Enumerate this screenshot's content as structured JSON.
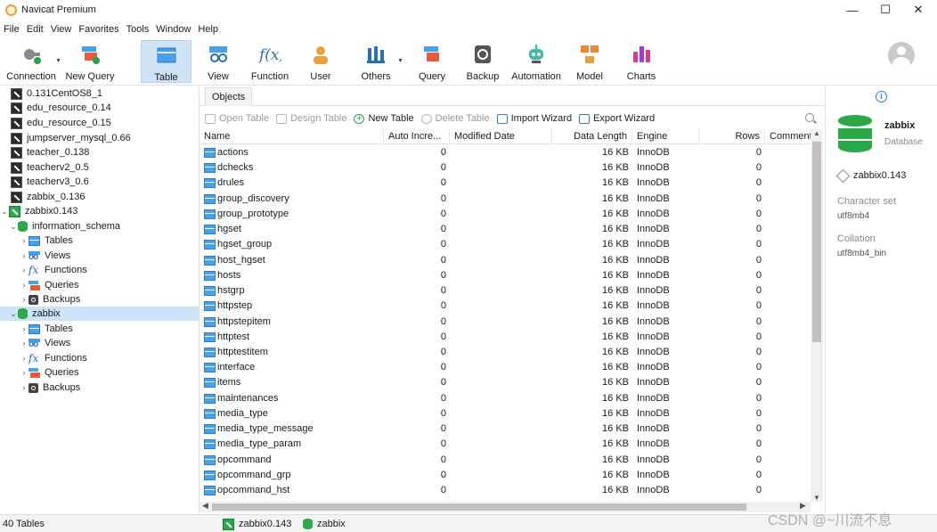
{
  "window": {
    "title": "Navicat Premium",
    "minimize": "—",
    "maximize": "☐",
    "close": "✕"
  },
  "menu": [
    "File",
    "Edit",
    "View",
    "Favorites",
    "Tools",
    "Window",
    "Help"
  ],
  "toolbar": {
    "items": [
      {
        "label": "Connection",
        "icon": "connection-icon"
      },
      {
        "label": "New Query",
        "icon": "new-query-icon"
      },
      {
        "label": "Table",
        "icon": "table-icon",
        "active": true
      },
      {
        "label": "View",
        "icon": "view-icon"
      },
      {
        "label": "Function",
        "icon": "function-icon"
      },
      {
        "label": "User",
        "icon": "user-icon"
      },
      {
        "label": "Others",
        "icon": "others-icon"
      },
      {
        "label": "Query",
        "icon": "query-icon"
      },
      {
        "label": "Backup",
        "icon": "backup-icon"
      },
      {
        "label": "Automation",
        "icon": "automation-icon"
      },
      {
        "label": "Model",
        "icon": "model-icon"
      },
      {
        "label": "Charts",
        "icon": "charts-icon"
      }
    ]
  },
  "navigator": {
    "connections": [
      {
        "label": "0.131CentOS8_1"
      },
      {
        "label": "edu_resource_0.14"
      },
      {
        "label": "edu_resource_0.15"
      },
      {
        "label": "jumpserver_mysql_0.66"
      },
      {
        "label": "teacher_0.138"
      },
      {
        "label": "teacherv2_0.5"
      },
      {
        "label": "teacherv3_0.6"
      },
      {
        "label": "zabbix_0.136"
      }
    ],
    "open_connection": "zabbix0.143",
    "databases": [
      {
        "label": "information_schema",
        "children": [
          "Tables",
          "Views",
          "Functions",
          "Queries",
          "Backups"
        ]
      },
      {
        "label": "zabbix",
        "selected": true,
        "children": [
          "Tables",
          "Views",
          "Functions",
          "Queries",
          "Backups"
        ]
      }
    ]
  },
  "tabs": {
    "objects": "Objects"
  },
  "object_toolbar": {
    "open_table": "Open Table",
    "design_table": "Design Table",
    "new_table": "New Table",
    "delete_table": "Delete Table",
    "import_wizard": "Import Wizard",
    "export_wizard": "Export Wizard"
  },
  "grid": {
    "columns": [
      "Name",
      "Auto Incre...",
      "Modified Date",
      "Data Length",
      "Engine",
      "Rows",
      "Comment"
    ],
    "rows": [
      {
        "name": "actions",
        "auto": "0",
        "modified": "",
        "length": "16 KB",
        "engine": "InnoDB",
        "rows": "0"
      },
      {
        "name": "dchecks",
        "auto": "0",
        "modified": "",
        "length": "16 KB",
        "engine": "InnoDB",
        "rows": "0"
      },
      {
        "name": "drules",
        "auto": "0",
        "modified": "",
        "length": "16 KB",
        "engine": "InnoDB",
        "rows": "0"
      },
      {
        "name": "group_discovery",
        "auto": "0",
        "modified": "",
        "length": "16 KB",
        "engine": "InnoDB",
        "rows": "0"
      },
      {
        "name": "group_prototype",
        "auto": "0",
        "modified": "",
        "length": "16 KB",
        "engine": "InnoDB",
        "rows": "0"
      },
      {
        "name": "hgset",
        "auto": "0",
        "modified": "",
        "length": "16 KB",
        "engine": "InnoDB",
        "rows": "0"
      },
      {
        "name": "hgset_group",
        "auto": "0",
        "modified": "",
        "length": "16 KB",
        "engine": "InnoDB",
        "rows": "0"
      },
      {
        "name": "host_hgset",
        "auto": "0",
        "modified": "",
        "length": "16 KB",
        "engine": "InnoDB",
        "rows": "0"
      },
      {
        "name": "hosts",
        "auto": "0",
        "modified": "",
        "length": "16 KB",
        "engine": "InnoDB",
        "rows": "0"
      },
      {
        "name": "hstgrp",
        "auto": "0",
        "modified": "",
        "length": "16 KB",
        "engine": "InnoDB",
        "rows": "0"
      },
      {
        "name": "httpstep",
        "auto": "0",
        "modified": "",
        "length": "16 KB",
        "engine": "InnoDB",
        "rows": "0"
      },
      {
        "name": "httpstepitem",
        "auto": "0",
        "modified": "",
        "length": "16 KB",
        "engine": "InnoDB",
        "rows": "0"
      },
      {
        "name": "httptest",
        "auto": "0",
        "modified": "",
        "length": "16 KB",
        "engine": "InnoDB",
        "rows": "0"
      },
      {
        "name": "httptestitem",
        "auto": "0",
        "modified": "",
        "length": "16 KB",
        "engine": "InnoDB",
        "rows": "0"
      },
      {
        "name": "interface",
        "auto": "0",
        "modified": "",
        "length": "16 KB",
        "engine": "InnoDB",
        "rows": "0"
      },
      {
        "name": "items",
        "auto": "0",
        "modified": "",
        "length": "16 KB",
        "engine": "InnoDB",
        "rows": "0"
      },
      {
        "name": "maintenances",
        "auto": "0",
        "modified": "",
        "length": "16 KB",
        "engine": "InnoDB",
        "rows": "0"
      },
      {
        "name": "media_type",
        "auto": "0",
        "modified": "",
        "length": "16 KB",
        "engine": "InnoDB",
        "rows": "0"
      },
      {
        "name": "media_type_message",
        "auto": "0",
        "modified": "",
        "length": "16 KB",
        "engine": "InnoDB",
        "rows": "0"
      },
      {
        "name": "media_type_param",
        "auto": "0",
        "modified": "",
        "length": "16 KB",
        "engine": "InnoDB",
        "rows": "0"
      },
      {
        "name": "opcommand",
        "auto": "0",
        "modified": "",
        "length": "16 KB",
        "engine": "InnoDB",
        "rows": "0"
      },
      {
        "name": "opcommand_grp",
        "auto": "0",
        "modified": "",
        "length": "16 KB",
        "engine": "InnoDB",
        "rows": "0"
      },
      {
        "name": "opcommand_hst",
        "auto": "0",
        "modified": "",
        "length": "16 KB",
        "engine": "InnoDB",
        "rows": "0"
      }
    ]
  },
  "info_panel": {
    "db_name": "zabbix",
    "db_type": "Database",
    "connection": "zabbix0.143",
    "charset_label": "Character set",
    "charset_value": "utf8mb4",
    "collation_label": "Collation",
    "collation_value": "utf8mb4_bin"
  },
  "status": {
    "count": "40 Tables",
    "connection": "zabbix0.143",
    "database": "zabbix"
  },
  "watermark": "CSDN @~川流不息"
}
